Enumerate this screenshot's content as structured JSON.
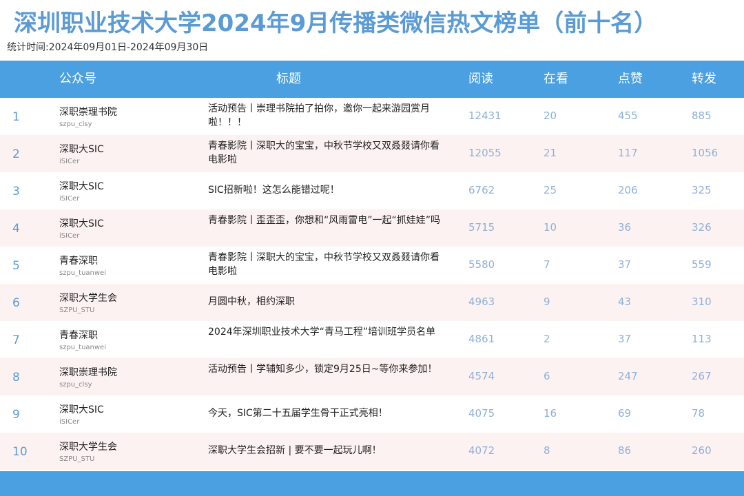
{
  "title": "深圳职业技术大学2024年9月传播类微信热文榜单（前十名）",
  "period": "统计时间:2024年09月01日-2024年09月30日",
  "columns": {
    "account": "公众号",
    "headline": "标题",
    "reads": "阅读",
    "views": "在看",
    "likes": "点赞",
    "shares": "转发"
  },
  "rows": [
    {
      "rank": "1",
      "account": "深职崇理书院",
      "account_id": "szpu_clsy",
      "headline": "活动预告丨崇理书院拍了拍你，邀你一起来游园赏月啦！！！",
      "reads": "12431",
      "views": "20",
      "likes": "455",
      "shares": "885"
    },
    {
      "rank": "2",
      "account": "深职大SIC",
      "account_id": "iSICer",
      "headline": "青春影院丨深职大的宝宝，中秋节学校又双叒叕请你看电影啦",
      "reads": "12055",
      "views": "21",
      "likes": "117",
      "shares": "1056"
    },
    {
      "rank": "3",
      "account": "深职大SIC",
      "account_id": "iSICer",
      "headline": "SIC招新啦！这怎么能错过呢！",
      "reads": "6762",
      "views": "25",
      "likes": "206",
      "shares": "325"
    },
    {
      "rank": "4",
      "account": "深职大SIC",
      "account_id": "iSICer",
      "headline": "青春影院丨歪歪歪，你想和“风雨雷电”一起“抓娃娃”吗",
      "reads": "5715",
      "views": "10",
      "likes": "36",
      "shares": "326"
    },
    {
      "rank": "5",
      "account": "青春深职",
      "account_id": "szpu_tuanwei",
      "headline": "青春影院丨深职大的宝宝，中秋节学校又双叒叕请你看电影啦",
      "reads": "5580",
      "views": "7",
      "likes": "37",
      "shares": "559"
    },
    {
      "rank": "6",
      "account": "深职大学生会",
      "account_id": "SZPU_STU",
      "headline": "月圆中秋，相约深职",
      "reads": "4963",
      "views": "9",
      "likes": "43",
      "shares": "310"
    },
    {
      "rank": "7",
      "account": "青春深职",
      "account_id": "szpu_tuanwei",
      "headline": "2024年深圳职业技术大学“青马工程”培训班学员名单",
      "reads": "4861",
      "views": "2",
      "likes": "37",
      "shares": "113"
    },
    {
      "rank": "8",
      "account": "深职崇理书院",
      "account_id": "szpu_clsy",
      "headline": "活动预告丨学辅知多少，锁定9月25日~等你来参加！",
      "reads": "4574",
      "views": "6",
      "likes": "247",
      "shares": "267"
    },
    {
      "rank": "9",
      "account": "深职大SIC",
      "account_id": "iSICer",
      "headline": "今天，SIC第二十五届学生骨干正式亮相！",
      "reads": "4075",
      "views": "16",
      "likes": "69",
      "shares": "78"
    },
    {
      "rank": "10",
      "account": "深职大学生会",
      "account_id": "SZPU_STU",
      "headline": "深职大学生会招新 | 要不要一起玩儿啊！",
      "reads": "4072",
      "views": "8",
      "likes": "86",
      "shares": "260"
    }
  ]
}
